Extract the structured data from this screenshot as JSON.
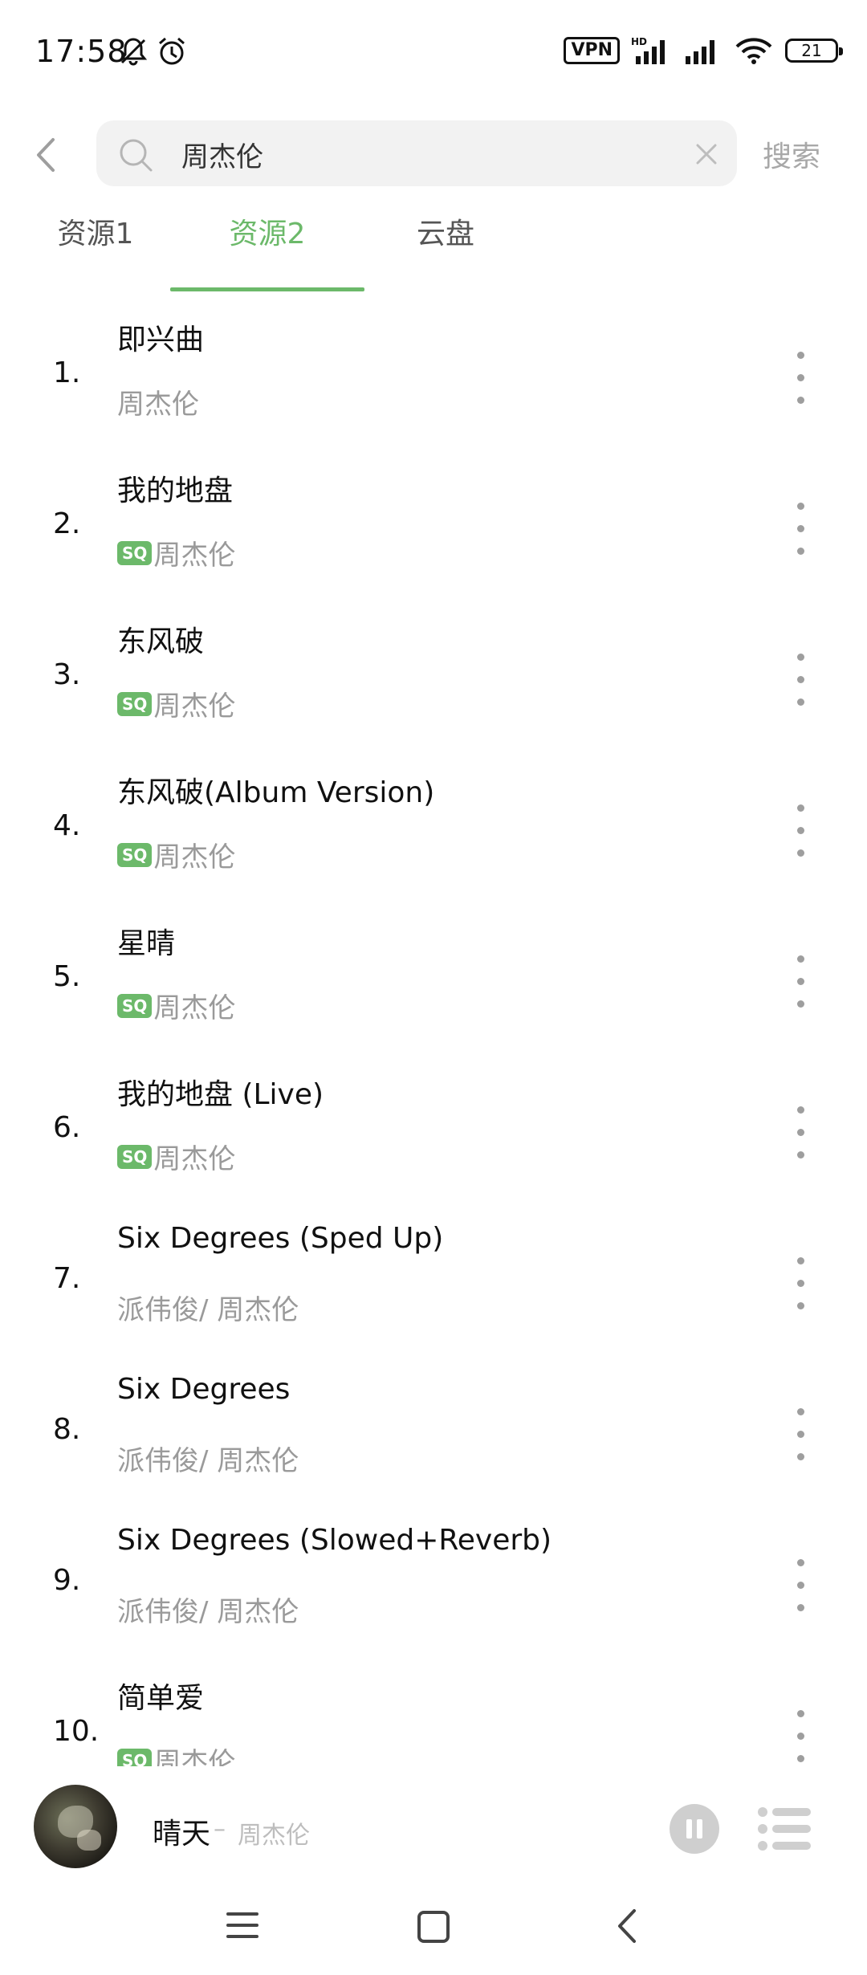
{
  "status_bar": {
    "time": "17:58",
    "left_icons": [
      "bell-off-icon",
      "alarm-icon"
    ],
    "vpn_label": "VPN",
    "hd_label": "HD",
    "battery_level": "21"
  },
  "search": {
    "query": "周杰伦",
    "button_label": "搜索"
  },
  "tabs": [
    {
      "label": "资源1",
      "active": false
    },
    {
      "label": "资源2",
      "active": true
    },
    {
      "label": "云盘",
      "active": false
    }
  ],
  "songs": [
    {
      "num": "1.",
      "title": "即兴曲",
      "sq": false,
      "artist": "周杰伦"
    },
    {
      "num": "2.",
      "title": "我的地盘",
      "sq": true,
      "sq_label": "SQ",
      "artist": "周杰伦"
    },
    {
      "num": "3.",
      "title": "东风破",
      "sq": true,
      "sq_label": "SQ",
      "artist": "周杰伦"
    },
    {
      "num": "4.",
      "title": "东风破(Album Version)",
      "sq": true,
      "sq_label": "SQ",
      "artist": "周杰伦"
    },
    {
      "num": "5.",
      "title": "星晴",
      "sq": true,
      "sq_label": "SQ",
      "artist": "周杰伦"
    },
    {
      "num": "6.",
      "title": "我的地盘 (Live)",
      "sq": true,
      "sq_label": "SQ",
      "artist": "周杰伦"
    },
    {
      "num": "7.",
      "title": "Six Degrees (Sped Up)",
      "sq": false,
      "artist": "派伟俊/ 周杰伦"
    },
    {
      "num": "8.",
      "title": "Six Degrees",
      "sq": false,
      "artist": "派伟俊/ 周杰伦"
    },
    {
      "num": "9.",
      "title": "Six Degrees (Slowed+Reverb)",
      "sq": false,
      "artist": "派伟俊/ 周杰伦"
    },
    {
      "num": "10.",
      "title": "简单爱",
      "sq": true,
      "sq_label": "SQ",
      "artist": "周杰伦"
    }
  ],
  "player": {
    "title": "晴天",
    "separator": "–",
    "artist": "周杰伦",
    "state": "playing"
  },
  "colors": {
    "accent": "#6cb96a",
    "text_primary": "#111111",
    "text_secondary": "#9a9a9a"
  }
}
